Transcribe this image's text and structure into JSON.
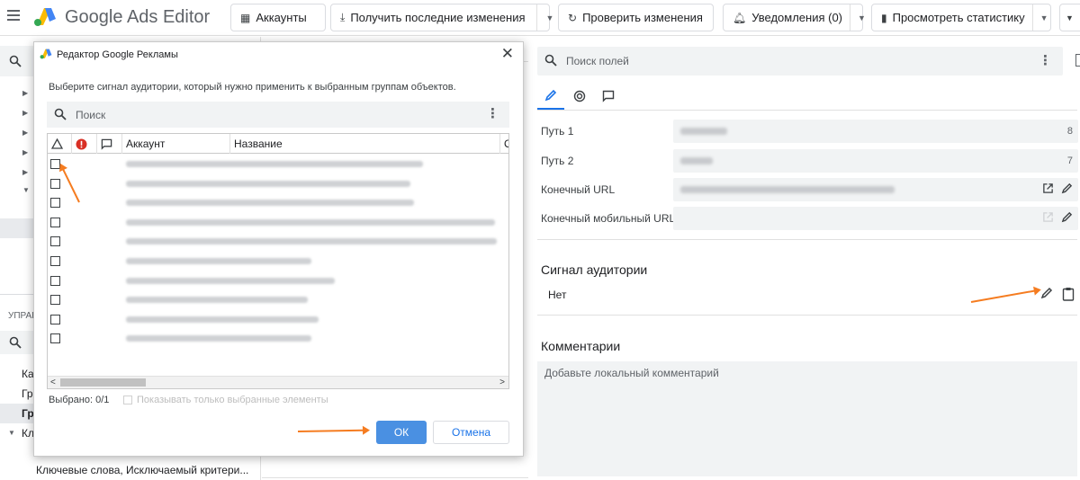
{
  "app": {
    "title": "Google Ads Editor"
  },
  "toolbar": {
    "accounts": "Аккаунты",
    "get_changes": "Получить последние изменения",
    "check_changes": "Проверить изменения",
    "notifications": "Уведомления (0)",
    "view_stats": "Просмотреть статистику"
  },
  "left_panel": {
    "section_label": "УПРАВ",
    "items": [
      "Ка",
      "Гр",
      "Гр",
      "Кл"
    ],
    "bottom_item": "Ключевые слова, Исключаемый критери..."
  },
  "right_panel": {
    "search_placeholder": "Поиск полей",
    "fields": [
      {
        "label": "Путь 1",
        "count": "8"
      },
      {
        "label": "Путь 2",
        "count": "7"
      },
      {
        "label": "Конечный URL",
        "count": ""
      },
      {
        "label": "Конечный мобильный URL",
        "count": ""
      }
    ],
    "audience_heading": "Сигнал аудитории",
    "audience_value": "Нет",
    "comments_heading": "Комментарии",
    "comments_placeholder": "Добавьте локальный комментарий"
  },
  "dialog": {
    "title": "Редактор Google Рекламы",
    "description": "Выберите сигнал аудитории, который нужно применить к выбранным группам объектов.",
    "search_placeholder": "Поиск",
    "columns": {
      "account": "Аккаунт",
      "name": "Название",
      "extra": "О"
    },
    "rows": 10,
    "selected": "Выбрано: 0/1",
    "show_only_selected": "Показывать только выбранные элементы",
    "ok": "ОК",
    "cancel": "Отмена"
  },
  "colors": {
    "accent": "#1a73e8",
    "ok_button": "#4a90e2",
    "arrow": "#f57c20",
    "error": "#d93025"
  }
}
